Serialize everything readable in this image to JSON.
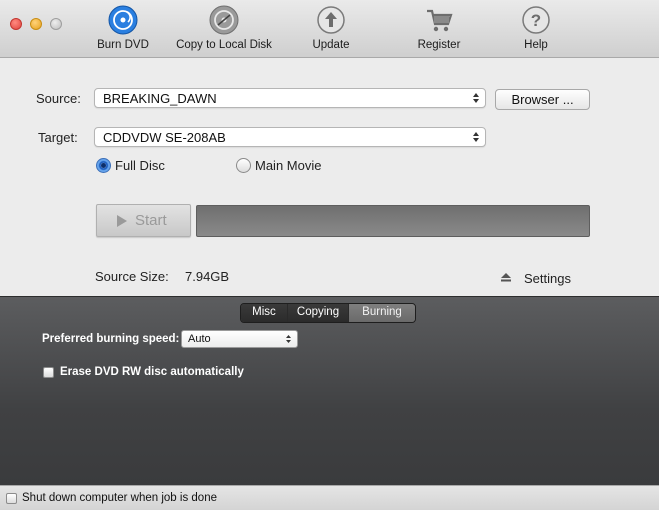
{
  "toolbar": {
    "items": [
      {
        "label": "Burn DVD",
        "icon": "burn-dvd-icon",
        "active": true
      },
      {
        "label": "Copy to Local Disk",
        "icon": "copy-disk-icon"
      },
      {
        "label": "Update",
        "icon": "update-icon"
      },
      {
        "label": "Register",
        "icon": "cart-icon"
      },
      {
        "label": "Help",
        "icon": "help-icon"
      }
    ]
  },
  "source": {
    "label": "Source:",
    "value": "BREAKING_DAWN",
    "browse_label": "Browser ..."
  },
  "target": {
    "label": "Target:",
    "value": "CDDVDW SE-208AB"
  },
  "mode": {
    "full_disc": "Full Disc",
    "main_movie": "Main Movie",
    "selected": "Full Disc"
  },
  "start": {
    "label": "Start"
  },
  "progress": {
    "value": 0
  },
  "source_size": {
    "label": "Source Size:",
    "value": "7.94GB"
  },
  "settings": {
    "label": "Settings"
  },
  "tabs": [
    {
      "label": "Misc"
    },
    {
      "label": "Copying"
    },
    {
      "label": "Burning"
    }
  ],
  "burning": {
    "speed_label": "Preferred burning speed:",
    "speed_value": "Auto",
    "erase_label": "Erase DVD RW disc automatically",
    "erase_checked": false
  },
  "footer": {
    "shutdown_label": "Shut down computer when job is done",
    "shutdown_checked": false
  },
  "colors": {
    "accent_blue": "#1e6fd0",
    "panel_dark": "#404143"
  }
}
